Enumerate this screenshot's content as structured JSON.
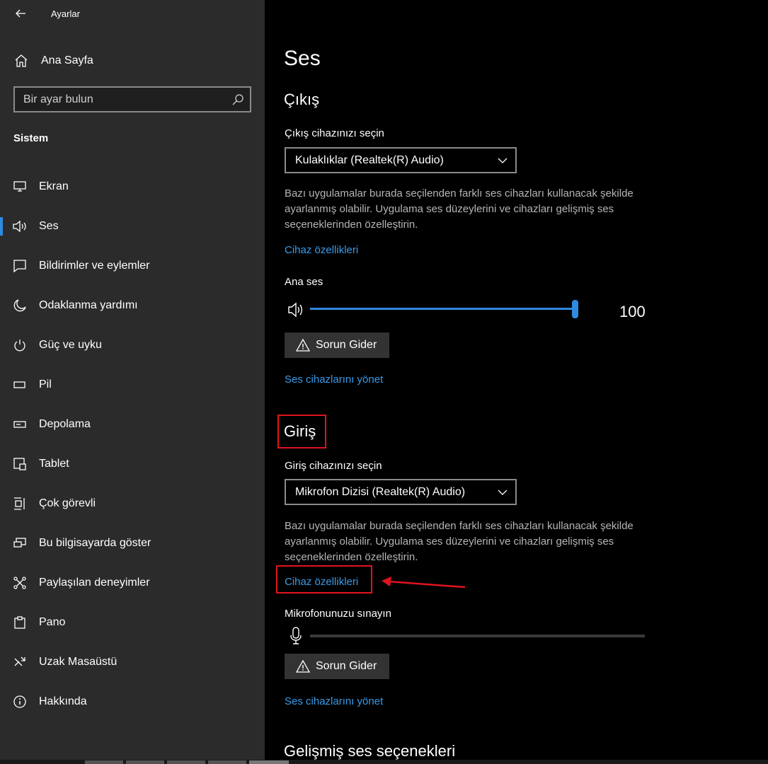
{
  "window": {
    "app_title": "Ayarlar"
  },
  "sidebar": {
    "home_label": "Ana Sayfa",
    "search_placeholder": "Bir ayar bulun",
    "section_label": "Sistem",
    "items": [
      {
        "label": "Ekran",
        "icon": "monitor-icon"
      },
      {
        "label": "Ses",
        "icon": "speaker-icon",
        "active": true
      },
      {
        "label": "Bildirimler ve eylemler",
        "icon": "notification-icon"
      },
      {
        "label": "Odaklanma yardımı",
        "icon": "moon-icon"
      },
      {
        "label": "Güç ve uyku",
        "icon": "power-icon"
      },
      {
        "label": "Pil",
        "icon": "battery-icon"
      },
      {
        "label": "Depolama",
        "icon": "storage-icon"
      },
      {
        "label": "Tablet",
        "icon": "tablet-icon"
      },
      {
        "label": "Çok görevli",
        "icon": "multitasking-icon"
      },
      {
        "label": "Bu bilgisayarda göster",
        "icon": "project-icon"
      },
      {
        "label": "Paylaşılan deneyimler",
        "icon": "shared-icon"
      },
      {
        "label": "Pano",
        "icon": "clipboard-icon"
      },
      {
        "label": "Uzak Masaüstü",
        "icon": "remote-icon"
      },
      {
        "label": "Hakkında",
        "icon": "info-icon"
      }
    ]
  },
  "main": {
    "page_title": "Ses",
    "output": {
      "heading": "Çıkış",
      "select_label": "Çıkış cihazınızı seçin",
      "selected_device": "Kulaklıklar (Realtek(R) Audio)",
      "description": "Bazı uygulamalar burada seçilenden farklı ses cihazları kullanacak şekilde ayarlanmış olabilir. Uygulama ses düzeylerini ve cihazları gelişmiş ses seçeneklerinden özelleştirin.",
      "device_properties_link": "Cihaz özellikleri",
      "volume_label": "Ana ses",
      "volume_value": "100",
      "troubleshoot_label": "Sorun Gider",
      "manage_devices_link": "Ses cihazlarını yönet"
    },
    "input": {
      "heading": "Giriş",
      "select_label": "Giriş cihazınızı seçin",
      "selected_device": "Mikrofon Dizisi (Realtek(R) Audio)",
      "description": "Bazı uygulamalar burada seçilenden farklı ses cihazları kullanacak şekilde ayarlanmış olabilir. Uygulama ses düzeylerini ve cihazları gelişmiş ses seçeneklerinden özelleştirin.",
      "device_properties_link": "Cihaz özellikleri",
      "test_label": "Mikrofonunuzu sınayın",
      "troubleshoot_label": "Sorun Gider",
      "manage_devices_link": "Ses cihazlarını yönet"
    },
    "advanced_heading": "Gelişmiş ses seçenekleri"
  },
  "colors": {
    "accent": "#2f8ae0",
    "link": "#3a9be8",
    "annotation": "#e0141e",
    "sidebar_bg": "#2b2b2b"
  }
}
